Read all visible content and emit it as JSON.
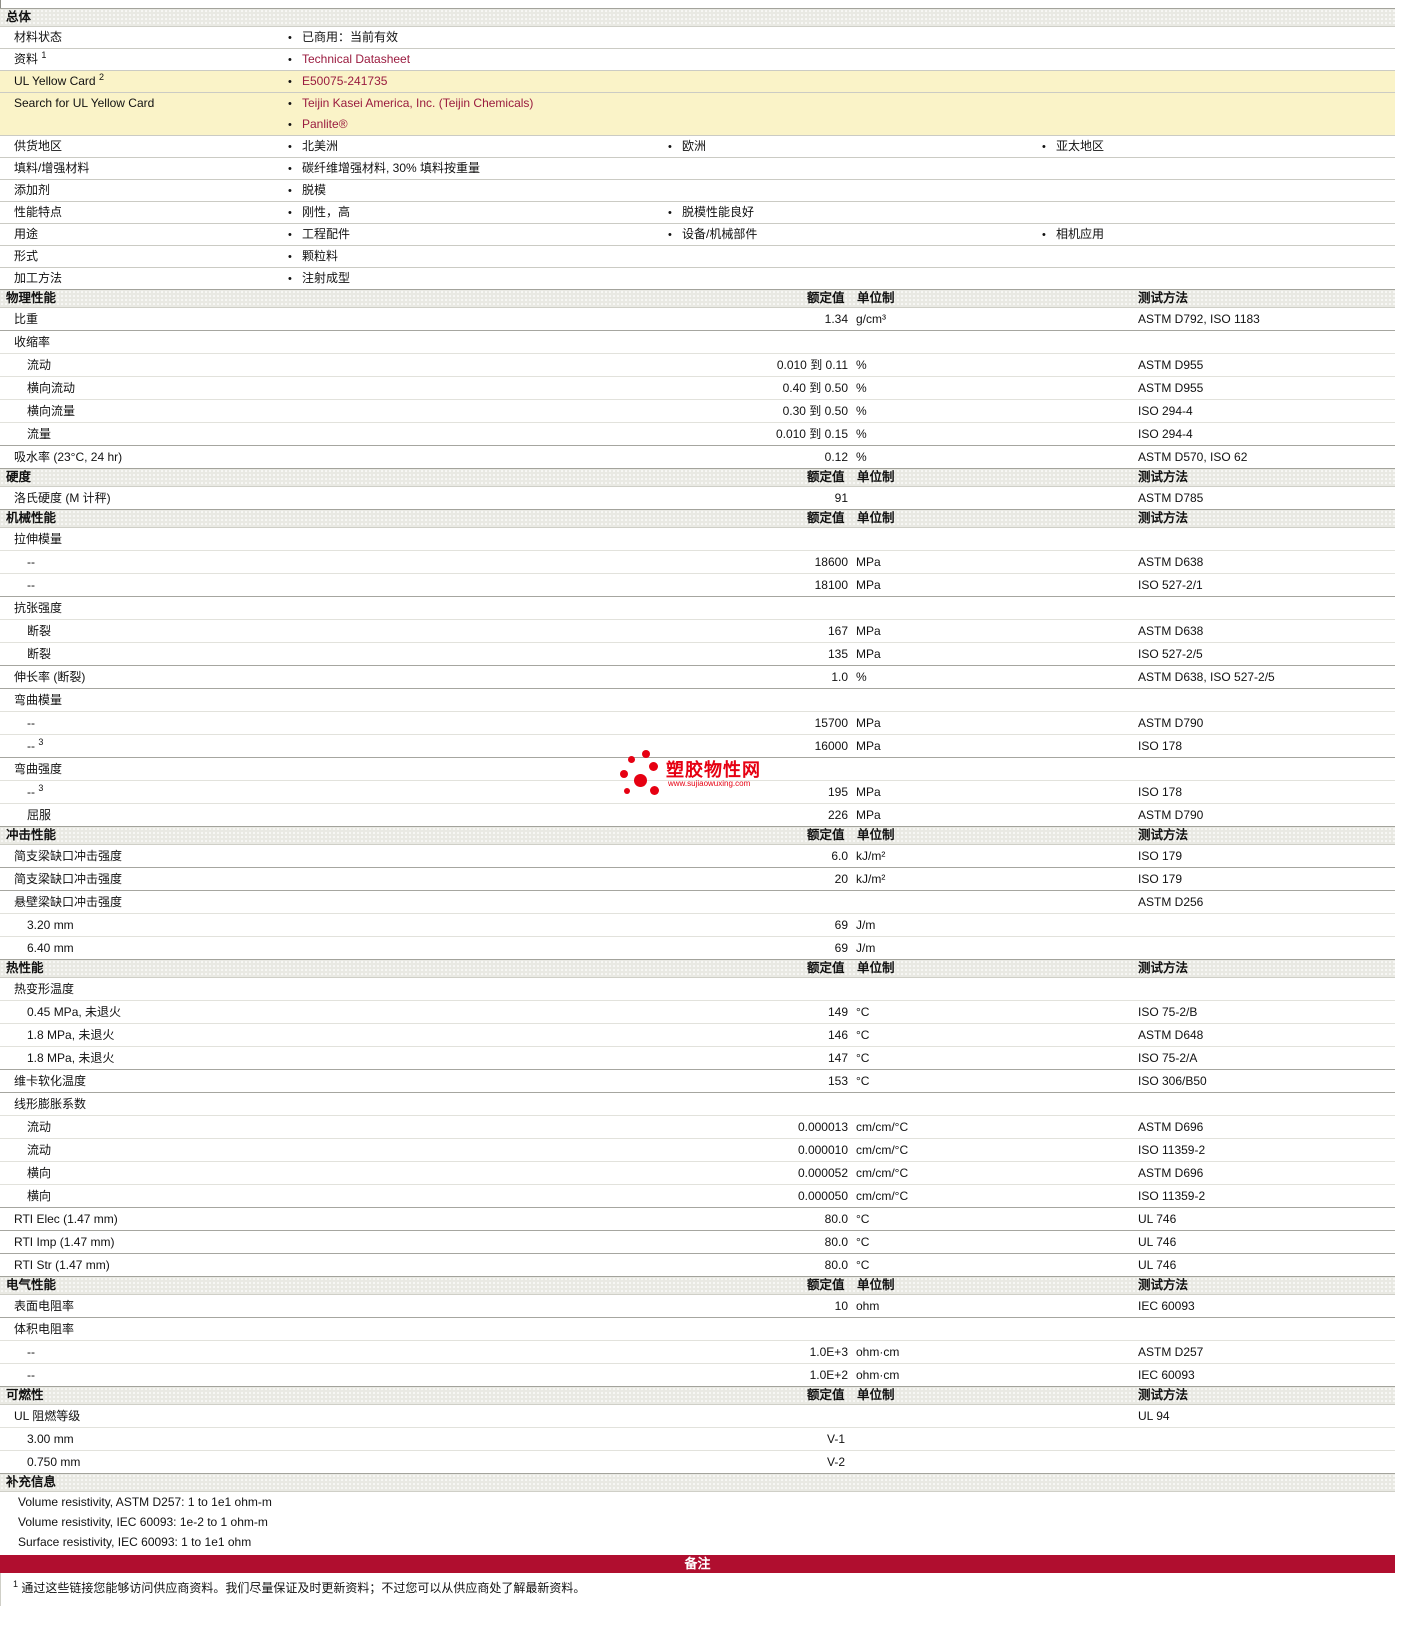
{
  "colors": {
    "link": "#9a1b3f",
    "banner_bg": "#b00e2f",
    "row_highlight": "#faf3c8",
    "watermark_red": "#e60012",
    "section_header_bg": "#e9e9e3"
  },
  "columns": {
    "value": "额定值",
    "unit": "单位制",
    "method": "测试方法"
  },
  "general": {
    "title": "总体",
    "rows": [
      {
        "label": "材料状态",
        "lines": [
          [
            {
              "text": "已商用：当前有效",
              "col": 0
            }
          ]
        ]
      },
      {
        "label": "资料",
        "sup": "1",
        "lines": [
          [
            {
              "text": "Technical Datasheet",
              "col": 0,
              "link": true
            }
          ]
        ]
      },
      {
        "label": "UL Yellow Card",
        "sup": "2",
        "highlight": true,
        "lines": [
          [
            {
              "text": "E50075-241735",
              "col": 0,
              "link": true
            }
          ]
        ]
      },
      {
        "label": "Search for UL Yellow Card",
        "highlight": true,
        "lines": [
          [
            {
              "text": "Teijin Kasei America, Inc. (Teijin Chemicals)",
              "col": 0,
              "link": true
            }
          ],
          [
            {
              "text": "Panlite®",
              "col": 0,
              "link": true
            }
          ]
        ]
      },
      {
        "label": "供货地区",
        "lines": [
          [
            {
              "text": "北美洲",
              "col": 0
            },
            {
              "text": "欧洲",
              "col": 1
            },
            {
              "text": "亚太地区",
              "col": 2
            }
          ]
        ]
      },
      {
        "label": "填料/增强材料",
        "lines": [
          [
            {
              "text": "碳纤维增强材料, 30% 填料按重量",
              "col": 0
            }
          ]
        ]
      },
      {
        "label": "添加剂",
        "lines": [
          [
            {
              "text": "脱模",
              "col": 0
            }
          ]
        ]
      },
      {
        "label": "性能特点",
        "lines": [
          [
            {
              "text": "刚性，高",
              "col": 0
            },
            {
              "text": "脱模性能良好",
              "col": 1
            }
          ]
        ]
      },
      {
        "label": "用途",
        "lines": [
          [
            {
              "text": "工程配件",
              "col": 0
            },
            {
              "text": "设备/机械部件",
              "col": 1
            },
            {
              "text": "相机应用",
              "col": 2
            }
          ]
        ]
      },
      {
        "label": "形式",
        "lines": [
          [
            {
              "text": "颗粒料",
              "col": 0
            }
          ]
        ]
      },
      {
        "label": "加工方法",
        "lines": [
          [
            {
              "text": "注射成型",
              "col": 0
            }
          ]
        ]
      }
    ]
  },
  "sections": [
    {
      "title": "物理性能",
      "rows": [
        {
          "label": "比重",
          "value": "1.34",
          "unit": "g/cm³",
          "method": "ASTM D792, ISO 1183",
          "major": true
        },
        {
          "label": "收缩率",
          "group": true,
          "major": true
        },
        {
          "label": "流动",
          "indent": true,
          "value": "0.010 到 0.11",
          "unit": "%",
          "method": "ASTM D955"
        },
        {
          "label": "横向流动",
          "indent": true,
          "value": "0.40 到 0.50",
          "unit": "%",
          "method": "ASTM D955"
        },
        {
          "label": "横向流量",
          "indent": true,
          "value": "0.30 到 0.50",
          "unit": "%",
          "method": "ISO 294-4"
        },
        {
          "label": "流量",
          "indent": true,
          "value": "0.010 到 0.15",
          "unit": "%",
          "method": "ISO 294-4"
        },
        {
          "label": "吸水率 (23°C, 24 hr)",
          "value": "0.12",
          "unit": "%",
          "method": "ASTM D570, ISO 62",
          "major": true
        }
      ]
    },
    {
      "title": "硬度",
      "rows": [
        {
          "label": "洛氏硬度 (M 计秤)",
          "value": "91",
          "unit": "",
          "method": "ASTM D785",
          "major": true
        }
      ]
    },
    {
      "title": "机械性能",
      "rows": [
        {
          "label": "拉伸模量",
          "group": true,
          "major": true
        },
        {
          "label": "--",
          "indent": true,
          "value": "18600",
          "unit": "MPa",
          "method": "ASTM D638"
        },
        {
          "label": "--",
          "indent": true,
          "value": "18100",
          "unit": "MPa",
          "method": "ISO 527-2/1"
        },
        {
          "label": "抗张强度",
          "group": true,
          "major": true
        },
        {
          "label": "断裂",
          "indent": true,
          "value": "167",
          "unit": "MPa",
          "method": "ASTM D638"
        },
        {
          "label": "断裂",
          "indent": true,
          "value": "135",
          "unit": "MPa",
          "method": "ISO 527-2/5"
        },
        {
          "label": "伸长率 (断裂)",
          "value": "1.0",
          "unit": "%",
          "method": "ASTM D638, ISO 527-2/5",
          "major": true
        },
        {
          "label": "弯曲模量",
          "group": true,
          "major": true
        },
        {
          "label": "--",
          "indent": true,
          "value": "15700",
          "unit": "MPa",
          "method": "ASTM D790"
        },
        {
          "label": "--",
          "sup": "3",
          "indent": true,
          "value": "16000",
          "unit": "MPa",
          "method": "ISO 178"
        },
        {
          "label": "弯曲强度",
          "group": true,
          "major": true
        },
        {
          "label": "--",
          "sup": "3",
          "indent": true,
          "value": "195",
          "unit": "MPa",
          "method": "ISO 178"
        },
        {
          "label": "屈服",
          "indent": true,
          "value": "226",
          "unit": "MPa",
          "method": "ASTM D790"
        }
      ]
    },
    {
      "title": "冲击性能",
      "rows": [
        {
          "label": "简支梁缺口冲击强度",
          "value": "6.0",
          "unit": "kJ/m²",
          "method": "ISO 179",
          "major": true
        },
        {
          "label": "简支梁缺口冲击强度",
          "value": "20",
          "unit": "kJ/m²",
          "method": "ISO 179",
          "major": true
        },
        {
          "label": "悬壁梁缺口冲击强度",
          "group": true,
          "method": "ASTM D256",
          "major": true
        },
        {
          "label": "3.20 mm",
          "indent": true,
          "value": "69",
          "unit": "J/m"
        },
        {
          "label": "6.40 mm",
          "indent": true,
          "value": "69",
          "unit": "J/m"
        }
      ]
    },
    {
      "title": "热性能",
      "rows": [
        {
          "label": "热变形温度",
          "group": true,
          "major": true
        },
        {
          "label": "0.45 MPa, 未退火",
          "indent": true,
          "value": "149",
          "unit": "°C",
          "method": "ISO 75-2/B"
        },
        {
          "label": "1.8 MPa, 未退火",
          "indent": true,
          "value": "146",
          "unit": "°C",
          "method": "ASTM D648"
        },
        {
          "label": "1.8 MPa, 未退火",
          "indent": true,
          "value": "147",
          "unit": "°C",
          "method": "ISO 75-2/A"
        },
        {
          "label": "维卡软化温度",
          "value": "153",
          "unit": "°C",
          "method": "ISO 306/B50",
          "major": true
        },
        {
          "label": "线形膨胀系数",
          "group": true,
          "major": true
        },
        {
          "label": "流动",
          "indent": true,
          "value": "0.000013",
          "unit": "cm/cm/°C",
          "method": "ASTM D696"
        },
        {
          "label": "流动",
          "indent": true,
          "value": "0.000010",
          "unit": "cm/cm/°C",
          "method": "ISO 11359-2"
        },
        {
          "label": "横向",
          "indent": true,
          "value": "0.000052",
          "unit": "cm/cm/°C",
          "method": "ASTM D696"
        },
        {
          "label": "横向",
          "indent": true,
          "value": "0.000050",
          "unit": "cm/cm/°C",
          "method": "ISO 11359-2"
        },
        {
          "label": "RTI Elec (1.47 mm)",
          "value": "80.0",
          "unit": "°C",
          "method": "UL 746",
          "major": true
        },
        {
          "label": "RTI Imp (1.47 mm)",
          "value": "80.0",
          "unit": "°C",
          "method": "UL 746",
          "major": true
        },
        {
          "label": "RTI Str (1.47 mm)",
          "value": "80.0",
          "unit": "°C",
          "method": "UL 746",
          "major": true
        }
      ]
    },
    {
      "title": "电气性能",
      "rows": [
        {
          "label": "表面电阻率",
          "value": "10",
          "unit": "ohm",
          "method": "IEC 60093",
          "major": true
        },
        {
          "label": "体积电阻率",
          "group": true,
          "major": true
        },
        {
          "label": "--",
          "indent": true,
          "value": "1.0E+3",
          "unit": "ohm·cm",
          "method": "ASTM D257"
        },
        {
          "label": "--",
          "indent": true,
          "value": "1.0E+2",
          "unit": "ohm·cm",
          "method": "IEC 60093"
        }
      ]
    },
    {
      "title": "可燃性",
      "rows": [
        {
          "label": "UL 阻燃等级",
          "group": true,
          "method": "UL 94",
          "major": true
        },
        {
          "label": "3.00 mm",
          "indent": true,
          "value": "V-1",
          "valpos": "mid"
        },
        {
          "label": "0.750 mm",
          "indent": true,
          "value": "V-2",
          "valpos": "mid"
        }
      ]
    }
  ],
  "supplemental": {
    "title": "补充信息",
    "lines": [
      "Volume resistivity, ASTM D257: 1 to 1e1 ohm-m",
      "Volume resistivity, IEC 60093: 1e-2 to 1 ohm-m",
      "Surface resistivity, IEC 60093: 1 to 1e1 ohm"
    ]
  },
  "notes": {
    "banner": "备注",
    "footnote_sup": "1",
    "footnote_text": "通过这些链接您能够访问供应商资料。我们尽量保证及时更新资料；不过您可以从供应商处了解最新资料。"
  },
  "watermark": {
    "brand": "塑胶物性网",
    "url": "www.sujiaowuxing.com"
  }
}
